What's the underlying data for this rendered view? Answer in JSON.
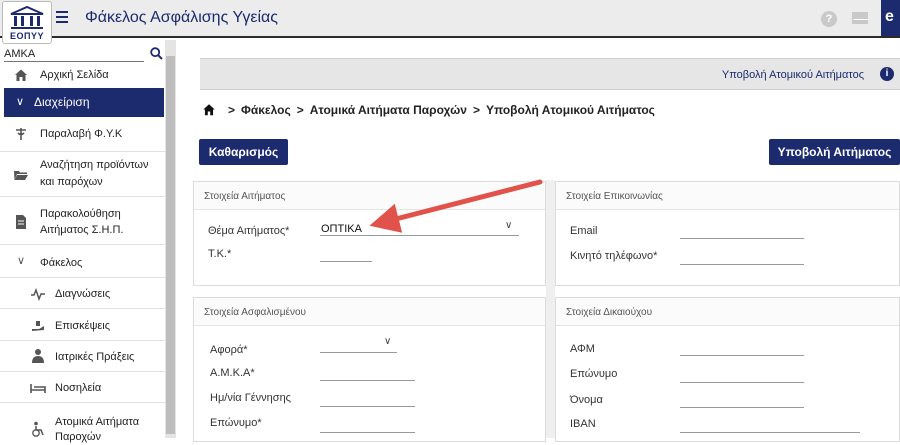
{
  "app": {
    "title": "Φάκελος Ασφάλισης Υγείας",
    "logo_text": "ΕΟΠΥΥ",
    "user_initial": "e",
    "help_glyph": "?"
  },
  "sidebar": {
    "search_placeholder": "ΑΜΚΑ",
    "items": [
      {
        "label": "Αρχική Σελίδα",
        "icon": "home-icon"
      },
      {
        "label": "Διαχείριση",
        "icon": "chevron-down-icon",
        "active": true
      },
      {
        "label": "Παραλαβή Φ.Υ.Κ",
        "icon": "pharmacy-icon"
      },
      {
        "label": "Αναζήτηση προϊόντων",
        "label2": "και παρόχων",
        "icon": "folder-open-icon"
      },
      {
        "label": "Παρακολούθηση",
        "label2": "Αιτήματος Σ.Η.Π.",
        "icon": "document-icon"
      },
      {
        "label": "Φάκελος",
        "icon": "chevron-down-icon"
      },
      {
        "label": "Διαγνώσεις",
        "icon": "pulse-icon"
      },
      {
        "label": "Επισκέψεις",
        "icon": "hand-care-icon"
      },
      {
        "label": "Ιατρικές Πράξεις",
        "icon": "doctor-icon"
      },
      {
        "label": "Νοσηλεία",
        "icon": "bed-icon"
      },
      {
        "label": "Ατομικά Αιτήματα",
        "label2": "Παροχών",
        "icon": "wheelchair-icon"
      }
    ]
  },
  "header": {
    "title": "Υποβολή Ατομικού Αιτήματος",
    "info_glyph": "i"
  },
  "breadcrumb": [
    "Φάκελος",
    "Ατομικά Αιτήματα Παροχών",
    "Υποβολή Ατομικού Αιτήματος"
  ],
  "actions": {
    "clear": "Καθαρισμός",
    "submit": "Υποβολή Αιτήματος"
  },
  "request": {
    "title": "Στοιχεία Αιτήματος",
    "subject_label": "Θέμα Αιτήματος*",
    "subject_value": "ΟΠΤΙΚΑ",
    "postcode_label": "Τ.Κ.*"
  },
  "contact": {
    "title": "Στοιχεία Επικοινωνίας",
    "email_label": "Email",
    "mobile_label": "Κινητό τηλέφωνο*"
  },
  "insured": {
    "title": "Στοιχεία Ασφαλισμένου",
    "regards_label": "Αφορά*",
    "amka_label": "Α.Μ.Κ.Α*",
    "dob_label": "Ημ/νία Γέννησης",
    "surname_label": "Επώνυμο*"
  },
  "beneficiary": {
    "title": "Στοιχεία Δικαιούχου",
    "afm_label": "ΑΦΜ",
    "surname_label": "Επώνυμο",
    "name_label": "Όνομα",
    "iban_label": "IBAN"
  },
  "colors": {
    "primary": "#1c2a6e",
    "annotation_arrow": "#e0524a"
  }
}
